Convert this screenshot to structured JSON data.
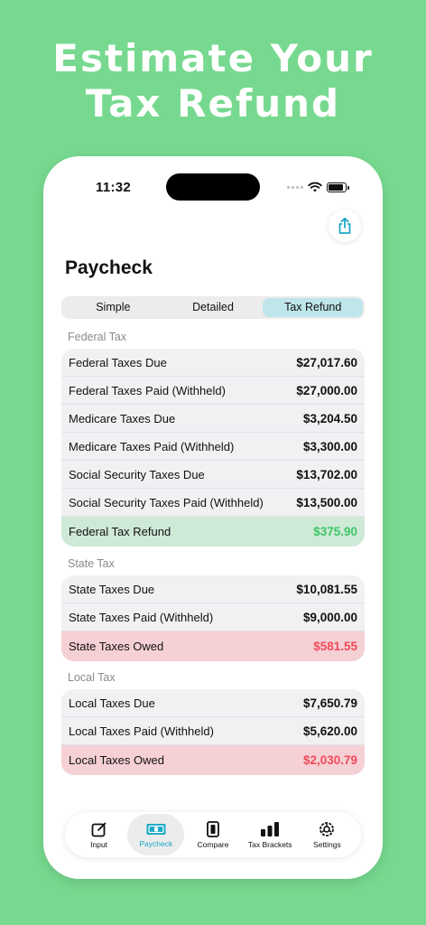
{
  "headline": {
    "line1": "Estimate Your",
    "line2": "Tax Refund"
  },
  "status_bar": {
    "time": "11:32"
  },
  "header": {
    "title": "Paycheck"
  },
  "segments": [
    {
      "label": "Simple",
      "active": false
    },
    {
      "label": "Detailed",
      "active": false
    },
    {
      "label": "Tax Refund",
      "active": true
    }
  ],
  "federal": {
    "section": "Federal Tax",
    "rows": [
      {
        "label": "Federal Taxes Due",
        "value": "$27,017.60"
      },
      {
        "label": "Federal Taxes Paid (Withheld)",
        "value": "$27,000.00"
      },
      {
        "label": "Medicare Taxes Due",
        "value": "$3,204.50"
      },
      {
        "label": "Medicare Taxes Paid (Withheld)",
        "value": "$3,300.00"
      },
      {
        "label": "Social Security Taxes Due",
        "value": "$13,702.00"
      },
      {
        "label": "Social Security Taxes Paid (Withheld)",
        "value": "$13,500.00"
      }
    ],
    "total": {
      "label": "Federal Tax Refund",
      "value": "$375.90"
    }
  },
  "state": {
    "section": "State Tax",
    "rows": [
      {
        "label": "State Taxes Due",
        "value": "$10,081.55"
      },
      {
        "label": "State Taxes Paid (Withheld)",
        "value": "$9,000.00"
      }
    ],
    "total": {
      "label": "State Taxes Owed",
      "value": "$581.55"
    }
  },
  "local": {
    "section": "Local Tax",
    "rows": [
      {
        "label": "Local Taxes Due",
        "value": "$7,650.79"
      },
      {
        "label": "Local Taxes Paid (Withheld)",
        "value": "$5,620.00"
      }
    ],
    "total": {
      "label": "Local Taxes Owed",
      "value": "$2,030.79"
    }
  },
  "tabbar": [
    {
      "label": "Input",
      "icon": "edit-icon",
      "active": false
    },
    {
      "label": "Paycheck",
      "icon": "money-icon",
      "active": true
    },
    {
      "label": "Compare",
      "icon": "compare-icon",
      "active": false
    },
    {
      "label": "Tax Brackets",
      "icon": "bar-chart-icon",
      "active": false
    },
    {
      "label": "Settings",
      "icon": "gear-icon",
      "active": false
    }
  ],
  "colors": {
    "background": "#77d98f",
    "accent": "#1aa8c4",
    "refund": "#3cc766",
    "owed": "#f24b5a"
  }
}
